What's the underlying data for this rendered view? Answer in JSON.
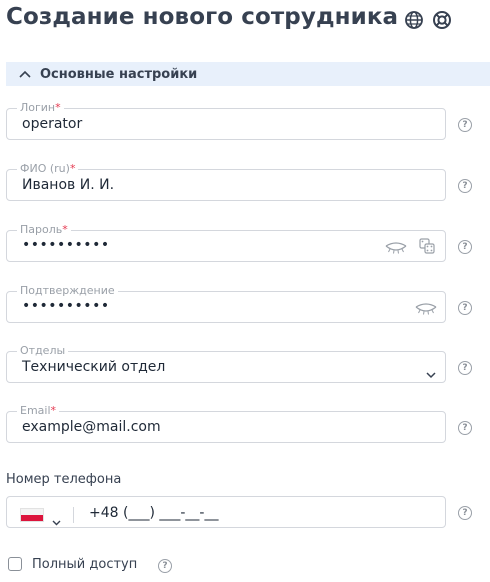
{
  "header": {
    "title": "Создание нового сотрудника",
    "icons": [
      "globe-icon",
      "lifebuoy-icon"
    ]
  },
  "section": {
    "label": "Основные настройки",
    "expanded": true
  },
  "fields": {
    "login": {
      "label": "Логин",
      "required_mark": "*",
      "value": "operator"
    },
    "fio": {
      "label": "ФИО (ru)",
      "required_mark": "*",
      "value": "Иванов И. И."
    },
    "password": {
      "label": "Пароль",
      "required_mark": "*",
      "value": "••••••••••"
    },
    "confirm": {
      "label": "Подтверждение",
      "value": "••••••••••"
    },
    "department": {
      "label": "Отделы",
      "value": "Технический отдел"
    },
    "email": {
      "label": "Email",
      "required_mark": "*",
      "value": "example@mail.com"
    }
  },
  "phone": {
    "label": "Номер телефона",
    "country_flag": "poland-flag",
    "value": "+48 (___) ___-__-__"
  },
  "full_access": {
    "label": "Полный доступ",
    "checked": false
  },
  "help_symbol": "?",
  "colors": {
    "section_bg": "#e8f0fb",
    "required": "#e53950",
    "border": "#d4d7dd"
  }
}
